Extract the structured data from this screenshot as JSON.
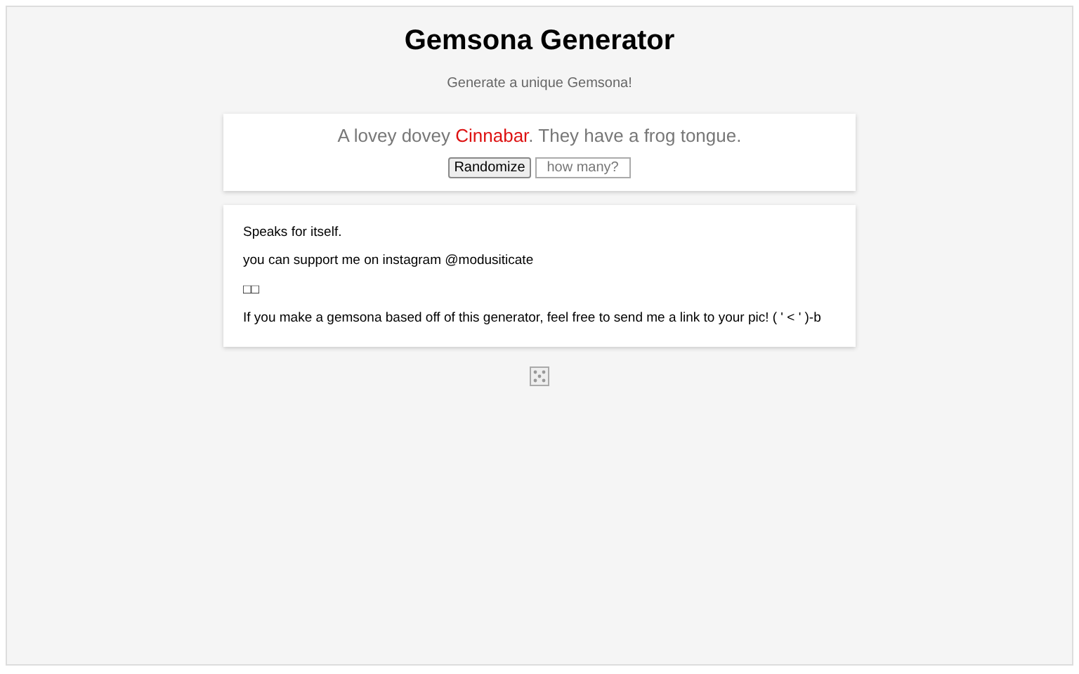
{
  "title": "Gemsona Generator",
  "subtitle": "Generate a unique Gemsona!",
  "result": {
    "before": "A lovey dovey",
    "gem": "Cinnabar",
    "after": ". They have a frog tongue."
  },
  "randomize_button": "Randomize",
  "count_field": {
    "placeholder": "how many?"
  },
  "notes": [
    "Speaks for itself.",
    "you can support me on instagram @modusiticate",
    "□□",
    "If you make a gemsona based off of this generator, feel free to send me a link to your pic! ( ' < ' )-b"
  ]
}
